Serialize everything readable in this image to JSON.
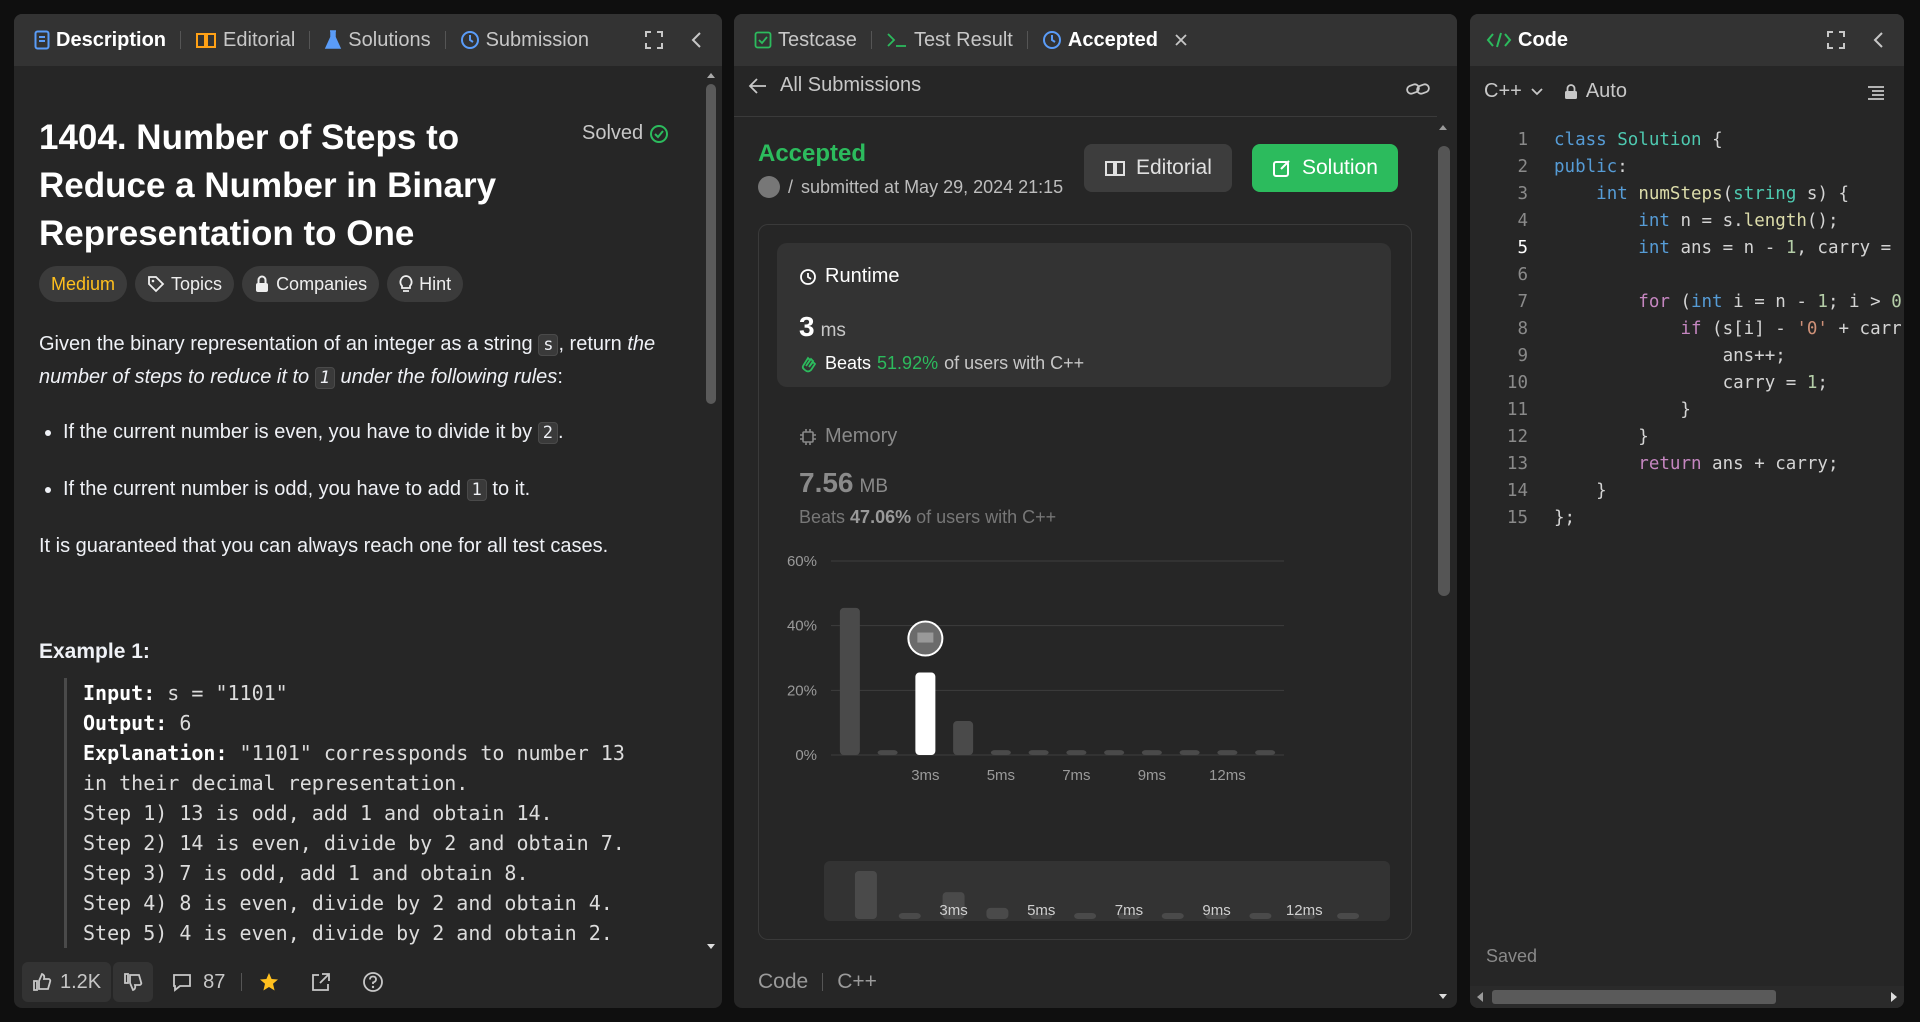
{
  "left": {
    "tabs": [
      "Description",
      "Editorial",
      "Solutions",
      "Submission"
    ],
    "title": "1404. Number of Steps to Reduce a Number in Binary Representation to One",
    "solved": "Solved",
    "pills": [
      "Medium",
      "Topics",
      "Companies",
      "Hint"
    ],
    "desc": {
      "p1_a": "Given the binary representation of an integer as a string ",
      "p1_code": "s",
      "p1_b": ", return ",
      "p1_i1": "the number of steps to reduce it to ",
      "p1_code2": "1",
      "p1_i2": " under the following rules",
      "p1_c": ":",
      "li1_a": "If the current number is even, you have to divide it by ",
      "li1_code": "2",
      "li1_b": ".",
      "li2_a": "If the current number is odd, you have to add ",
      "li2_code": "1",
      "li2_b": " to it.",
      "p2": "It is guaranteed that you can always reach one for all test cases."
    },
    "example_heading": "Example 1:",
    "example": {
      "input_label": "Input:",
      "input_value": " s = \"1101\"",
      "output_label": "Output:",
      "output_value": " 6",
      "explanation_label": "Explanation:",
      "explanation_value": " \"1101\" corressponds to number 13\nin their decimal representation.\nStep 1) 13 is odd, add 1 and obtain 14.\nStep 2) 14 is even, divide by 2 and obtain 7.\nStep 3) 7 is odd, add 1 and obtain 8.\nStep 4) 8 is even, divide by 2 and obtain 4.\nStep 5) 4 is even, divide by 2 and obtain 2."
    },
    "footer": {
      "likes": "1.2K",
      "comments": "87"
    }
  },
  "mid": {
    "tabs": [
      "Testcase",
      "Test Result",
      "Accepted"
    ],
    "back_label": "All Submissions",
    "status": "Accepted",
    "submitted_user": "/",
    "submitted": "submitted at May 29, 2024 21:15",
    "editorial_btn": "Editorial",
    "solution_btn": "Solution",
    "runtime": {
      "label": "Runtime",
      "value": "3",
      "unit": "ms",
      "beats_label": "Beats",
      "beats_pct": "51.92%",
      "beats_suffix": "of users with C++"
    },
    "memory": {
      "label": "Memory",
      "value": "7.56",
      "unit": "MB",
      "beats_label": "Beats",
      "beats_pct": "47.06%",
      "beats_suffix": "of users with C++"
    },
    "footer": [
      "Code",
      "C++"
    ]
  },
  "chart_data": {
    "type": "bar",
    "title": "",
    "ylabel": "",
    "xlabel": "",
    "y_ticks": [
      "60%",
      "40%",
      "20%",
      "0%"
    ],
    "ylim": [
      0,
      60
    ],
    "x_tick_labels": [
      "3ms",
      "5ms",
      "7ms",
      "9ms",
      "12ms"
    ],
    "x_tick_bar_index": [
      2,
      4,
      6,
      8,
      10
    ],
    "values": [
      45.5,
      1.5,
      25.5,
      10.5,
      1.5,
      1.5,
      1.5,
      1.5,
      1.5,
      1.5,
      1.5,
      1.5
    ],
    "highlighted_index": 2,
    "minimap_values": [
      45.5,
      1.5,
      25.5,
      10.5,
      1.5,
      1.5,
      1.5,
      1.5,
      1.5,
      1.5,
      1.5,
      1.5
    ],
    "colors": {
      "bar": "#4a4a4a",
      "highlight": "#ffffff",
      "grid": "#3d3d3d"
    }
  },
  "right": {
    "title": "Code",
    "lang": "C++",
    "mode": "Auto",
    "saved": "Saved",
    "lines": [
      "class Solution {",
      "public:",
      "    int numSteps(string s) {",
      "        int n = s.length();",
      "        int ans = n - 1, carry = ",
      "",
      "        for (int i = n - 1; i > 0",
      "            if (s[i] - '0' + carr",
      "                ans++;",
      "                carry = 1;",
      "            }",
      "        }",
      "        return ans + carry;",
      "    }",
      "};"
    ],
    "current_line": 5
  }
}
